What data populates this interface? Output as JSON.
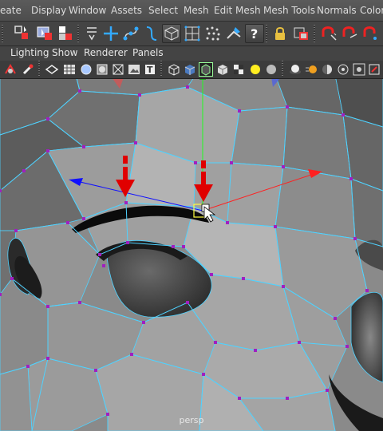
{
  "menubar": {
    "items": [
      "eate",
      "Display",
      "Window",
      "Assets",
      "Select",
      "Mesh",
      "Edit Mesh",
      "Mesh Tools",
      "Normals",
      "Color"
    ]
  },
  "toolbar": {
    "icons": [
      "select-component-icon",
      "lasso-select-icon",
      "paint-select-icon",
      "snap-icon",
      "move-tool-icon",
      "curve-tool-icon",
      "bend-icon",
      "face-mode-icon",
      "uv-icon",
      "vertex-mode-icon",
      "sculpt-icon",
      "help-icon",
      "lock-icon",
      "ipr-icon",
      "magnet-1-icon",
      "magnet-2-icon",
      "magnet-3-icon"
    ]
  },
  "panel_menu": {
    "items": [
      "Lighting",
      "Show",
      "Renderer",
      "Panels"
    ]
  },
  "viewport": {
    "camera_label": "persp",
    "colors": {
      "background": "#8a8a8a",
      "wire": "#4fd2ff",
      "vertex": "#a020c0",
      "annotation_arrow": "#e00000",
      "axis_x": "#ff2020",
      "axis_y": "#20ff20",
      "axis_z": "#1010ff",
      "selected_vertex": "#ffff40"
    }
  }
}
